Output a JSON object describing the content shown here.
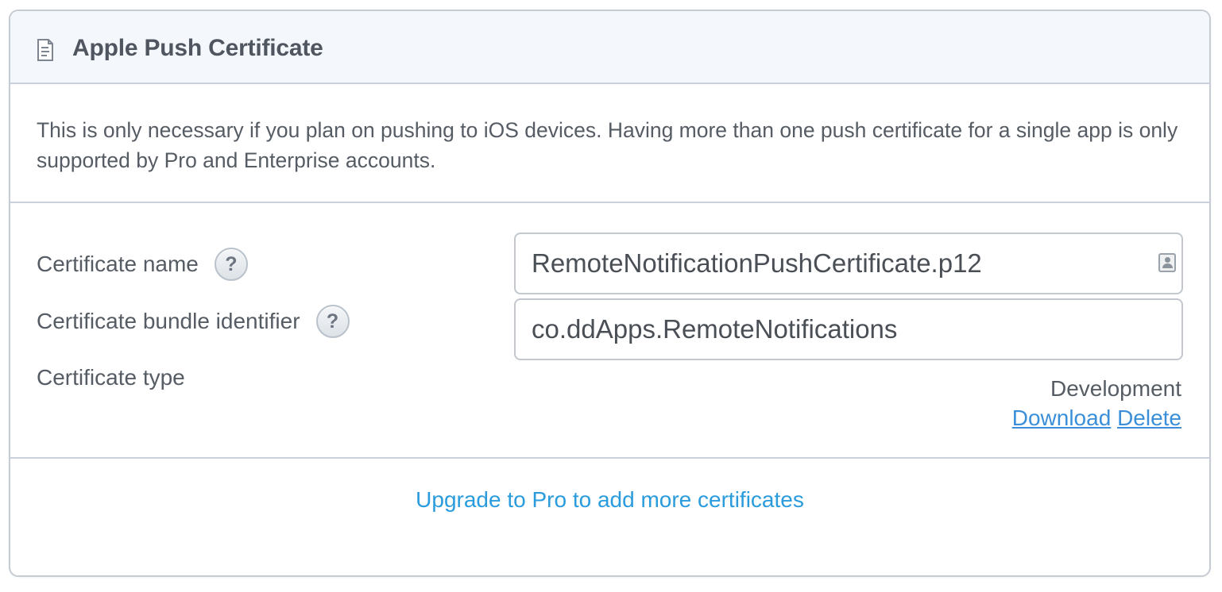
{
  "panel": {
    "title": "Apple Push Certificate",
    "icon": "document-icon",
    "description": "This is only necessary if you plan on pushing to iOS devices. Having more than one push certificate for a single app is only supported by Pro and Enterprise accounts."
  },
  "form": {
    "certificate_name": {
      "label": "Certificate name",
      "help": "?",
      "value": "RemoteNotificationPushCertificate.p12",
      "trailing_icon": "contact-card-icon"
    },
    "certificate_bundle_identifier": {
      "label": "Certificate bundle identifier",
      "help": "?",
      "value": "co.ddApps.RemoteNotifications"
    },
    "certificate_type": {
      "label": "Certificate type",
      "value": "Development"
    },
    "actions": {
      "download": "Download",
      "delete": "Delete"
    }
  },
  "footer": {
    "upgrade_link": "Upgrade to Pro to add more certificates"
  },
  "colors": {
    "header_bg": "#f4f8fc",
    "border": "#c8d1dc",
    "link": "#3b8fd9",
    "upgrade_link": "#2a9bdc",
    "text": "#565c64"
  }
}
